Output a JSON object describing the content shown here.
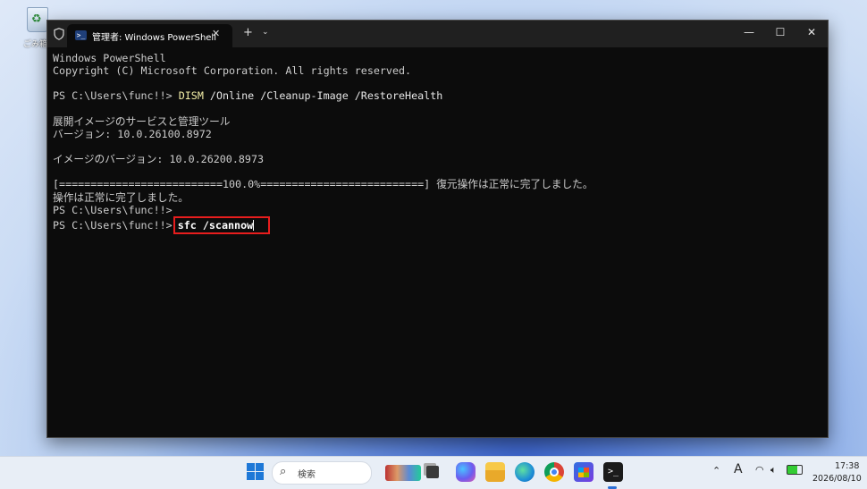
{
  "desktop": {
    "recycle_bin_label": "ごみ箱"
  },
  "window": {
    "tab_title": "管理者: Windows PowerShell",
    "tab_close": "✕",
    "new_tab": "+",
    "dropdown": "⌄",
    "minimize": "—",
    "maximize": "☐",
    "close": "✕"
  },
  "console": {
    "l1": "Windows PowerShell",
    "l2": "Copyright (C) Microsoft Corporation. All rights reserved.",
    "l4_prompt": "PS C:\\Users\\func!!> ",
    "l4_cmd": "DISM",
    "l4_args": " /Online /Cleanup-Image /RestoreHealth",
    "l6": "展開イメージのサービスと管理ツール",
    "l7": "バージョン: 10.0.26100.8972",
    "l9": "イメージのバージョン: 10.0.26200.8973",
    "l11": "[==========================100.0%==========================] 復元操作は正常に完了しました。",
    "l12": "操作は正常に完了しました。",
    "l13": "PS C:\\Users\\func!!>",
    "l14_prompt": "PS C:\\Users\\func!!>",
    "l14_cmd": "sfc /scannow"
  },
  "taskbar": {
    "search_placeholder": "検索",
    "ime": "A",
    "time": "17:38",
    "date": "2026/08/10"
  },
  "colors": {
    "highlight": "#e81d1d",
    "console_bg": "#0c0c0c",
    "accent": "#1e78d7"
  }
}
